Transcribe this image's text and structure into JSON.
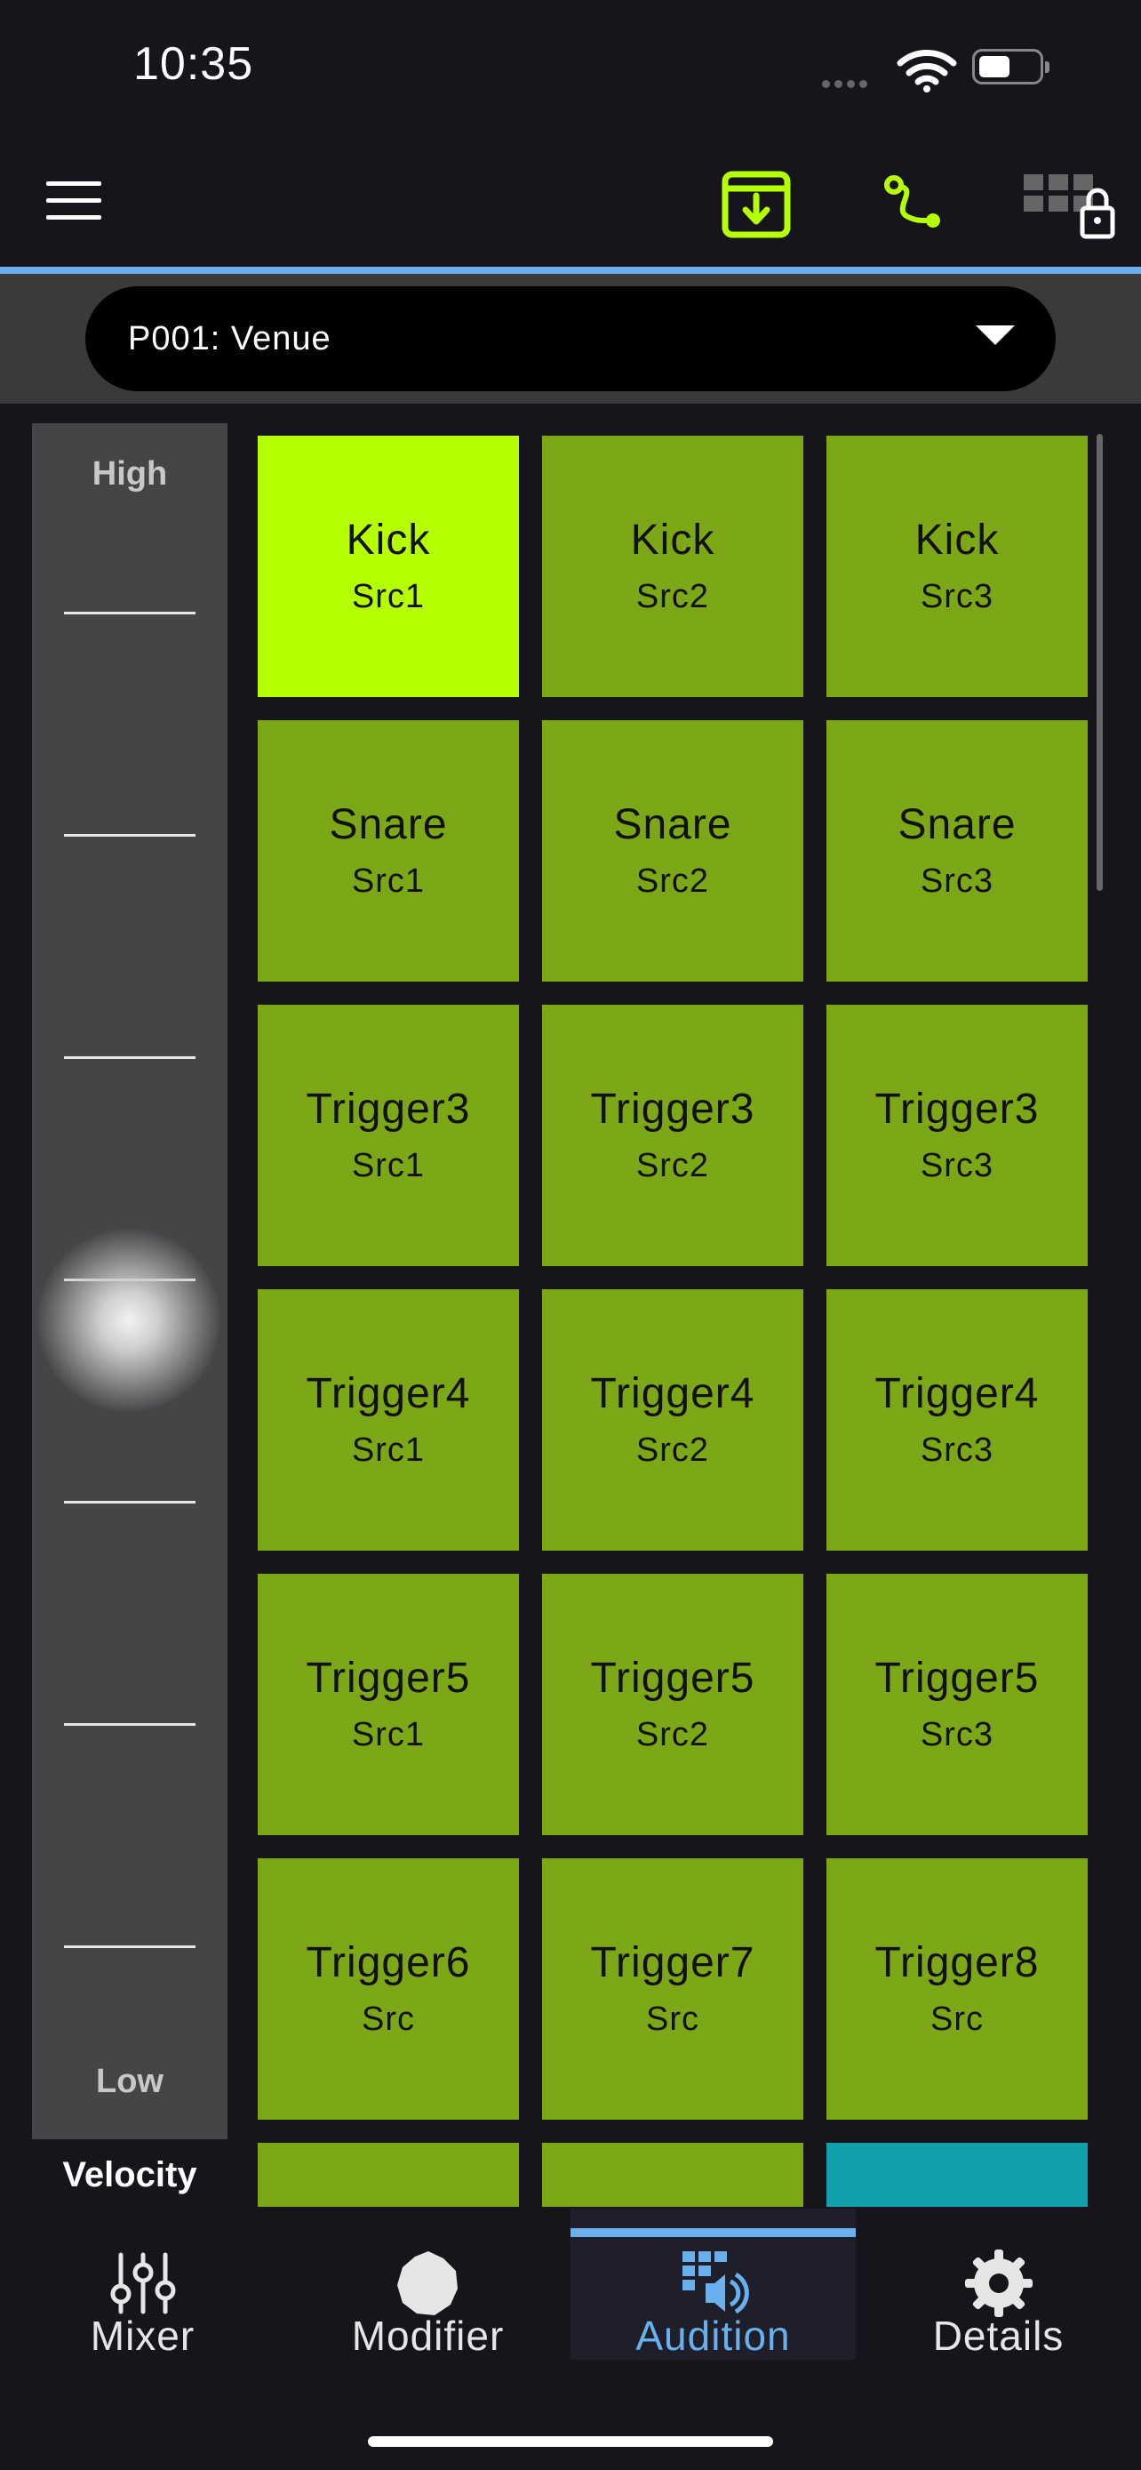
{
  "status": {
    "time": "10:35"
  },
  "toolbar": {
    "menu_icon": "hamburger-icon",
    "save_icon": "download-icon",
    "route_icon": "route-icon",
    "lock_icon": "grid-lock-icon",
    "accent": "#b6ff00"
  },
  "preset": {
    "label": "P001: Venue"
  },
  "velocity": {
    "high": "High",
    "low": "Low",
    "caption": "Velocity",
    "level": 0.45
  },
  "pads": [
    {
      "name": "Kick",
      "src": "Src1",
      "state": "active"
    },
    {
      "name": "Kick",
      "src": "Src2",
      "state": "normal"
    },
    {
      "name": "Kick",
      "src": "Src3",
      "state": "normal"
    },
    {
      "name": "Snare",
      "src": "Src1",
      "state": "normal"
    },
    {
      "name": "Snare",
      "src": "Src2",
      "state": "normal"
    },
    {
      "name": "Snare",
      "src": "Src3",
      "state": "normal"
    },
    {
      "name": "Trigger3",
      "src": "Src1",
      "state": "normal"
    },
    {
      "name": "Trigger3",
      "src": "Src2",
      "state": "normal"
    },
    {
      "name": "Trigger3",
      "src": "Src3",
      "state": "normal"
    },
    {
      "name": "Trigger4",
      "src": "Src1",
      "state": "normal"
    },
    {
      "name": "Trigger4",
      "src": "Src2",
      "state": "normal"
    },
    {
      "name": "Trigger4",
      "src": "Src3",
      "state": "normal"
    },
    {
      "name": "Trigger5",
      "src": "Src1",
      "state": "normal"
    },
    {
      "name": "Trigger5",
      "src": "Src2",
      "state": "normal"
    },
    {
      "name": "Trigger5",
      "src": "Src3",
      "state": "normal"
    },
    {
      "name": "Trigger6",
      "src": "Src",
      "state": "normal"
    },
    {
      "name": "Trigger7",
      "src": "Src",
      "state": "normal"
    },
    {
      "name": "Trigger8",
      "src": "Src",
      "state": "normal"
    },
    {
      "name": "",
      "src": "",
      "state": "normal"
    },
    {
      "name": "",
      "src": "",
      "state": "normal"
    },
    {
      "name": "",
      "src": "",
      "state": "teal"
    }
  ],
  "colors": {
    "pad": "#7ca716",
    "pad_active": "#b6ff00",
    "pad_teal": "#11a1ac",
    "accent_blue": "#6ab0ec"
  },
  "tabs": [
    {
      "label": "Mixer",
      "icon": "mixer-sliders-icon",
      "selected": false
    },
    {
      "label": "Modifier",
      "icon": "modifier-shape-icon",
      "selected": false
    },
    {
      "label": "Audition",
      "icon": "audition-icon",
      "selected": true
    },
    {
      "label": "Details",
      "icon": "gear-icon",
      "selected": false
    }
  ]
}
